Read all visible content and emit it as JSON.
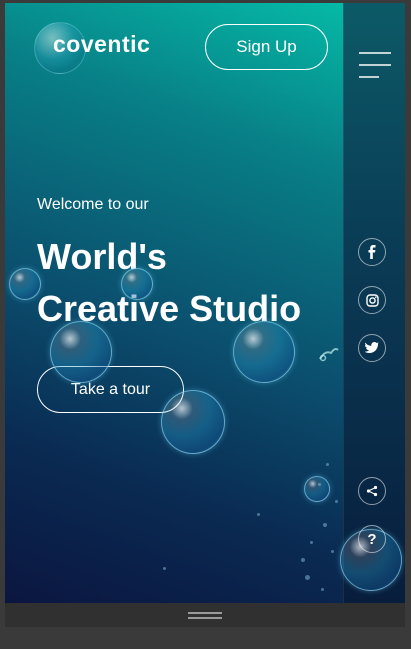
{
  "header": {
    "logo_text": "coventic",
    "signup_label": "Sign Up"
  },
  "hero": {
    "welcome": "Welcome to our",
    "headline_line1": "World's",
    "headline_line2": "Creative Studio",
    "tour_label": "Take a tour"
  },
  "rail": {
    "social": [
      "facebook-icon",
      "instagram-icon",
      "twitter-icon"
    ],
    "share_icon": "share-icon",
    "help_label": "?"
  },
  "colors": {
    "gradient_top": "#05c1ab",
    "gradient_bottom": "#0b1640",
    "text": "#ffffff"
  }
}
